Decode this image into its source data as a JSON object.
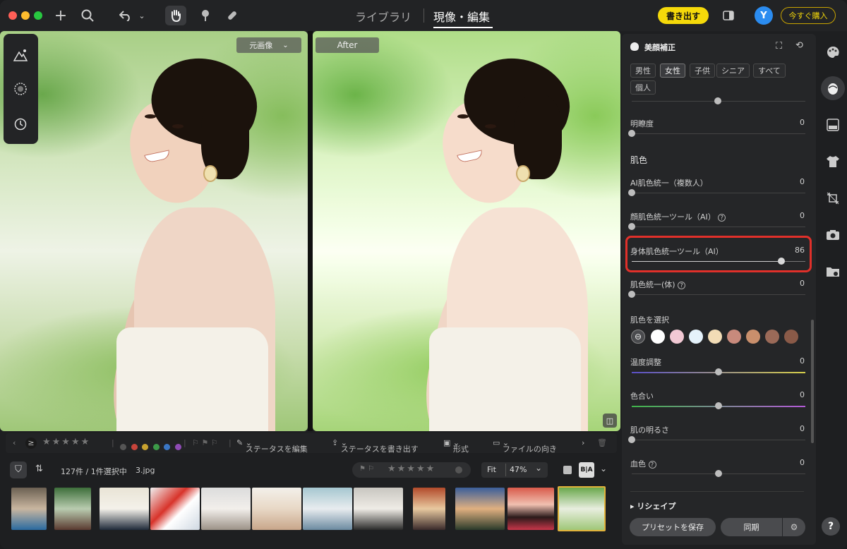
{
  "nav": {
    "library": "ライブラリ",
    "develop": "現像・編集",
    "export": "書き出す",
    "avatar_letter": "Y",
    "buy": "今すぐ購入"
  },
  "viewer": {
    "before_label": "元画像",
    "after_label": "After"
  },
  "filter_bar": {
    "edit_status": "ステータスを編集",
    "export_status": "ステータスを書き出す",
    "format": "形式",
    "orientation": "ファイルの向き",
    "rating_prefix": "≥"
  },
  "status_bar": {
    "count": "127件 / 1件選択中",
    "filename": "3.jpg",
    "fit": "Fit",
    "zoom": "47%"
  },
  "panel": {
    "title": "美顔補正",
    "chips": [
      "男性",
      "女性",
      "子供",
      "シニア",
      "すべて",
      "個人"
    ],
    "clarity": {
      "label": "明瞭度",
      "value": "0",
      "level": 0
    },
    "skin_section": "肌色",
    "sliders": [
      {
        "label": "AI肌色統一（複数人）",
        "value": "0",
        "level": 0
      },
      {
        "label": "顔肌色統一ツール（AI）",
        "value": "0",
        "level": 0
      },
      {
        "label": "身体肌色統一ツール（AI）",
        "value": "86",
        "level": 0.86
      },
      {
        "label": "肌色統一(体)",
        "value": "0",
        "level": 0
      }
    ],
    "select_skin": "肌色を選択",
    "swatch_colors": [
      "#ffffff",
      "#f2c9d4",
      "#e5f2fb",
      "#f2dcb6",
      "#c88a7c",
      "#c98f6c",
      "#9b6a58",
      "#8a5a48"
    ],
    "temp": {
      "label": "温度調整",
      "value": "0",
      "level": 0.5
    },
    "tint": {
      "label": "色合い",
      "value": "0",
      "level": 0.5
    },
    "brightness": {
      "label": "肌の明るさ",
      "value": "0",
      "level": 0
    },
    "blood": {
      "label": "血色",
      "value": "0",
      "level": 0.5
    },
    "reshape": "リシェイプ",
    "save_preset": "プリセットを保存",
    "sync": "同期"
  },
  "colors": {
    "accent_yellow": "#f5d90a",
    "highlight_red": "#e0302a",
    "avatar_blue": "#2b8cf0"
  }
}
